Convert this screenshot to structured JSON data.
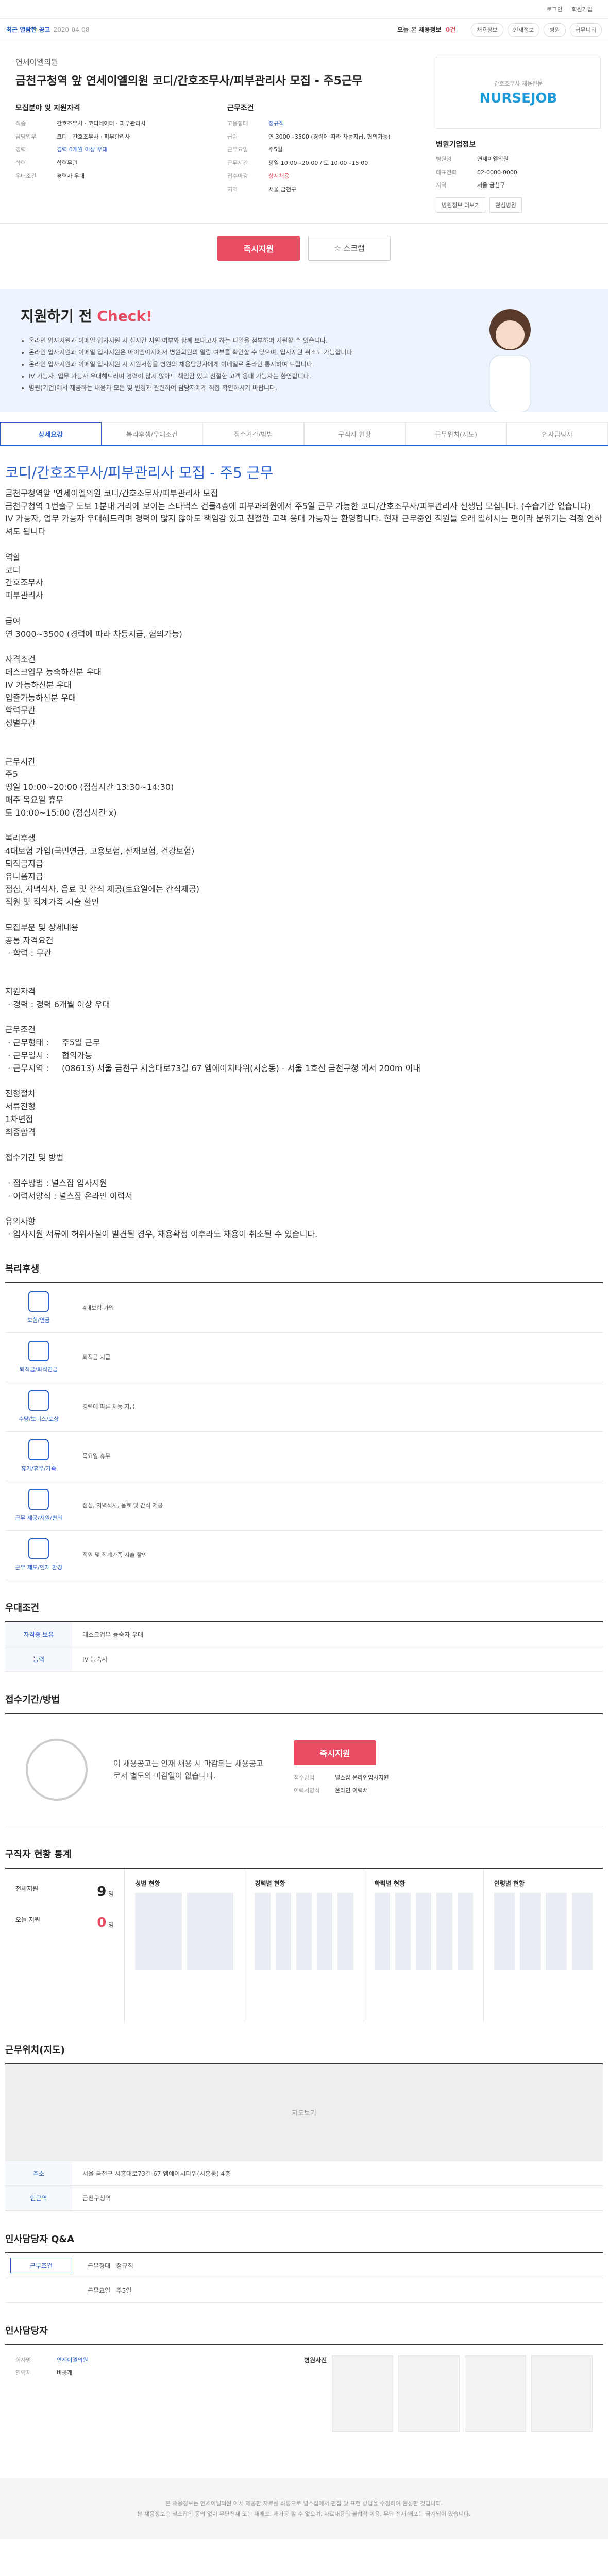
{
  "topbar": {
    "login": "로그인",
    "join": "회원가입"
  },
  "subbar": {
    "badge": "최근 열람한 공고",
    "date": "2020-04-08",
    "today": "오늘 본 채용정보",
    "count": "0건",
    "menu": [
      "채용정보",
      "인재정보",
      "병원",
      "커뮤니티"
    ]
  },
  "header": {
    "company": "연세이엘의원",
    "title": "금천구청역 앞 연세이엘의원 코디/간호조무사/피부관리사 모집 - 주5근무"
  },
  "recruit": {
    "heading": "모집분야 및 지원자격",
    "rows": [
      {
        "k": "직종",
        "v": "간호조무사 · 코디네이터 · 피부관리사"
      },
      {
        "k": "담당업무",
        "v": "코디 · 간호조무사 · 피부관리사"
      },
      {
        "k": "경력",
        "v": "경력 6개월 이상 우대"
      },
      {
        "k": "학력",
        "v": "학력무관"
      },
      {
        "k": "우대조건",
        "v": "경력자 우대"
      }
    ]
  },
  "cond": {
    "heading": "근무조건",
    "rows": [
      {
        "k": "고용형태",
        "v": "정규직"
      },
      {
        "k": "급여",
        "v": "연 3000~3500 (경력에 따라 차등지급, 협의가능)"
      },
      {
        "k": "근무요일",
        "v": "주5일"
      },
      {
        "k": "근무시간",
        "v": "평일 10:00~20:00 / 토 10:00~15:00"
      },
      {
        "k": "접수마감",
        "v": "상시채용"
      },
      {
        "k": "지역",
        "v": "서울 금천구"
      }
    ]
  },
  "hospital": {
    "logo_top": "간호조무사 채용전문",
    "logo": "NURSEJOB",
    "heading": "병원기업정보",
    "rows": [
      {
        "k": "병원명",
        "v": "연세이엘의원"
      },
      {
        "k": "대표전화",
        "v": "02-0000-0000"
      },
      {
        "k": "지역",
        "v": "서울 금천구"
      }
    ],
    "btn1": "병원정보 더보기",
    "btn2": "관심병원"
  },
  "actions": {
    "apply": "즉시지원",
    "scrap": "스크랩"
  },
  "check": {
    "title": "지원하기 전 ",
    "accent": "Check!",
    "items": [
      "온라인 입사지원과 이메일 입사지원 시 실시간 지원 여부와 함께 보내고자 하는 파일을 첨부하여 지원할 수 있습니다.",
      "온라인 입사지원과 이메일 입사지원은 아이엠이지에서 병원회원의 열람 여부를 확인할 수 있으며, 입사지원 취소도 가능합니다.",
      "온라인 입사지원과 이메일 입사지원 시 지원서항을 병원의 채용담당자에게 이메일로 온라인 통지하여 드립니다.",
      "IV 가능자, 업무 가능자 우대해드리며 경력이 많지 않아도 책임감 있고 친절한 고객 응대 가능자는 환영합니다.",
      "병원(기업)에서 제공하는 내용과 모든 및 변경과 관련하여 담당자에게 직접 확인하시기 바랍니다."
    ]
  },
  "tabs": [
    "상세요강",
    "복리후생/우대조건",
    "접수기간/방법",
    "구직자 현황",
    "근무위치(지도)",
    "인사담당자"
  ],
  "detail": {
    "title": "코디/간호조무사/피부관리사 모집 - 주5 근무",
    "body": "금천구청역앞 '연세이엘의원 코디/간호조무사/피부관리사 모집\n금천구청역 1번출구 도보 1분내 거리에 보이는 스타벅스 건물4층에 피부과의원에서 주5일 근무 가능한 코디/간호조무사/피부관리사 선생님 모십니다. (수습기간 없습니다)\nIV 가능자, 업무 가능자 우대해드리며 경력이 많지 않아도 책임감 있고 친절한 고객 응대 가능자는 환영합니다. 현재 근무중인 직원들 오래 일하시는 편이라 분위기는 걱정 안하셔도 됩니다\n\n역할\n코디\n간호조무사\n피부관리사\n\n급여\n연 3000~3500 (경력에 따라 차등지급, 협의가능)\n\n자격조건\n데스크업무 능숙하신분 우대\nIV 가능하신분 우대\n입출가능하신분 우대\n학력무관\n성별무관\n\n\n근무시간\n주5\n평일 10:00~20:00 (점심시간 13:30~14:30)\n매주 목요일 휴무\n토 10:00~15:00 (점심시간 x)\n\n복리후생\n4대보험 가입(국민연금, 고용보험, 산재보험, 건강보험)\n퇴직금지급\n유니폼지급\n점심, 저녁식사, 음료 및 간식 제공(토요일에는 간식제공)\n직원 및 직계가족 시술 할인\n\n모집부문 및 상세내용\n공통 자격요건\n · 학력 : 무관\n\n\n지원자격\n · 경력 : 경력 6개월 이상 우대\n\n근무조건\n · 근무형태 :     주5일 근무\n · 근무일시 :     협의가능\n · 근무지역 :     (08613) 서울 금천구 시흥대로73길 67 엠에이치타워(시흥동) - 서울 1호선 금천구청 에서 200m 이내\n\n전형절차\n서류전형\n1차면접\n최종합격\n\n접수기간 및 방법\n\n · 접수방법 : 널스잡 입사지원\n · 이력서양식 : 널스잡 온라인 이력서\n\n유의사항\n · 입사지원 서류에 허위사실이 발견될 경우, 채용확정 이후라도 채용이 취소될 수 있습니다."
  },
  "welfare": {
    "heading": "복리후생",
    "rows": [
      {
        "k": "보험/연금",
        "v": "4대보험 가입"
      },
      {
        "k": "퇴직금/퇴직연금",
        "v": "퇴직금 지급"
      },
      {
        "k": "수당/보너스/포상",
        "v": "경력에 따른 차등 지급"
      },
      {
        "k": "휴가/휴무/가족",
        "v": "목요일 휴무"
      },
      {
        "k": "근무 제공/지원/편의",
        "v": "점심, 저녁식사, 음료 및 간식 제공"
      },
      {
        "k": "근무 제도/인재 환경",
        "v": "직원 및 직계가족 시술 할인"
      }
    ]
  },
  "preference": {
    "heading": "우대조건",
    "rows": [
      {
        "k": "자격증 보유",
        "v": "데스크업무 능숙자 우대"
      },
      {
        "k": "능력",
        "v": "IV 능숙자"
      }
    ]
  },
  "method": {
    "heading": "접수기간/방법",
    "text": "이 채용공고는 인재 채용 시 마감되는 채용공고로서 별도의 마감일이 없습니다.",
    "apply": "즉시지원",
    "row1k": "접수방법",
    "row1v": "널스잡 온라인입사지원",
    "row2k": "이력서양식",
    "row2v": "온라인 이력서"
  },
  "stats": {
    "heading": "구직자 현황 통계",
    "total_label": "전체지원",
    "total": "9",
    "today_label": "오늘 지원",
    "today": "0",
    "unit": "명",
    "cols": [
      "성별 현황",
      "경력별 현황",
      "학력별 현황",
      "연령별 현황"
    ]
  },
  "location": {
    "heading": "근무위치(지도)",
    "map_label": "지도보기",
    "rows": [
      {
        "k": "주소",
        "v": "서울 금천구 시흥대로73길 67 엠에이치타워(시흥동) 4층"
      },
      {
        "k": "인근역",
        "v": "금천구청역"
      }
    ]
  },
  "qna": {
    "heading": "인사담당자 Q&A",
    "tab": "근무조건",
    "rows": [
      {
        "k": "근무형태",
        "v": "정규직"
      },
      {
        "k": "근무요일",
        "v": "주5일"
      }
    ]
  },
  "manager": {
    "heading": "인사담당자",
    "company_label": "회사명",
    "company": "연세이엘의원",
    "phone_label": "연락처",
    "phone": "비공개",
    "photo": "병원사진"
  },
  "footer": {
    "lines": [
      "본 채용정보는 연세이엘의원 에서 제공한 자료를 바탕으로 널스잡에서 편집 및 표현 방법을 수정하여 완성한 것입니다.",
      "본 채용정보는 널스잡의 동의 없이 무단전재 또는 재배포, 재가공 할 수 없으며, 자료내용의 불법적 이용, 무단 전재·배포는 금지되어 있습니다."
    ]
  }
}
